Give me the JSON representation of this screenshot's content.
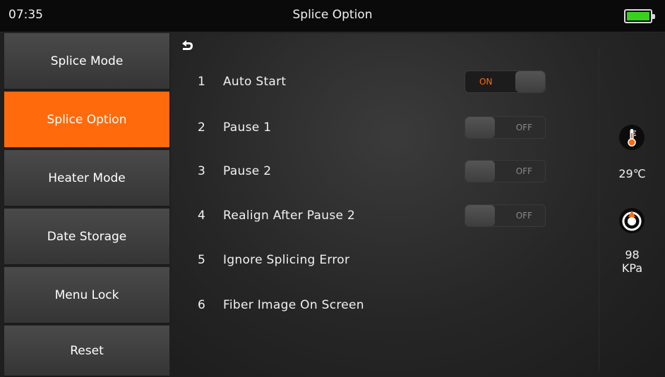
{
  "status_bar": {
    "time": "07:35",
    "title": "Splice Option",
    "battery_level": 1.0,
    "battery_color": "#39d11c"
  },
  "sidebar": {
    "items": [
      {
        "label": "Splice Mode",
        "active": false
      },
      {
        "label": "Splice Option",
        "active": true
      },
      {
        "label": "Heater Mode",
        "active": false
      },
      {
        "label": "Date Storage",
        "active": false
      },
      {
        "label": "Menu Lock",
        "active": false
      },
      {
        "label": "Reset",
        "active": false
      }
    ],
    "active_color": "#ff6a0c"
  },
  "main": {
    "back_icon": "back-arrow-icon",
    "options": [
      {
        "num": "1",
        "label": "Auto Start",
        "toggle": "ON"
      },
      {
        "num": "2",
        "label": "Pause 1",
        "toggle": "OFF"
      },
      {
        "num": "3",
        "label": "Pause 2",
        "toggle": "OFF"
      },
      {
        "num": "4",
        "label": "Realign After Pause 2",
        "toggle": "OFF"
      },
      {
        "num": "5",
        "label": "Ignore Splicing Error",
        "toggle": null
      },
      {
        "num": "6",
        "label": "Fiber Image On Screen",
        "toggle": null
      }
    ]
  },
  "status": {
    "temperature_icon": "thermometer-icon",
    "temperature": "29℃",
    "pressure_icon": "pressure-gauge-icon",
    "pressure_value": "98",
    "pressure_unit": "KPa"
  }
}
